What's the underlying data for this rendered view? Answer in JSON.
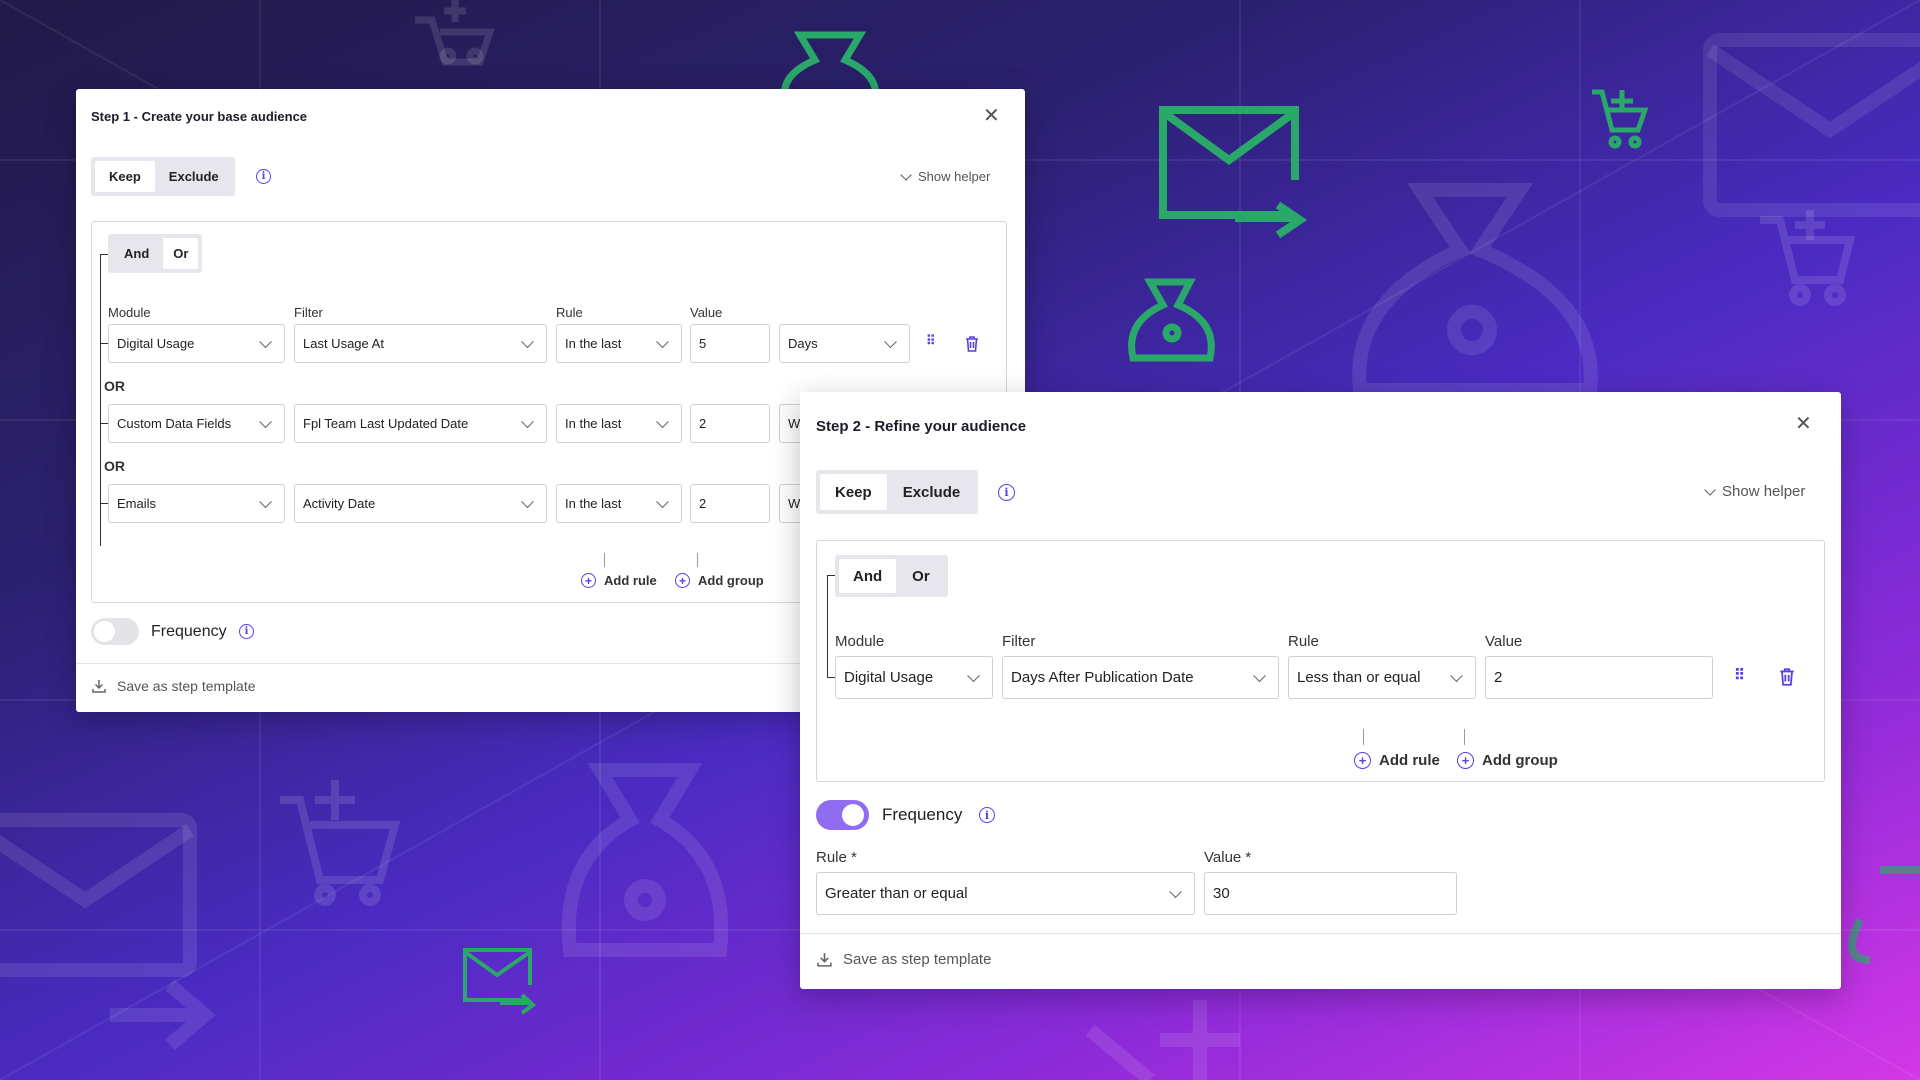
{
  "colors": {
    "accent": "#5b3fe0",
    "toggle_on": "#8f6cf0",
    "toggle_off": "#e3e3e8",
    "decor_green": "#2aa86a"
  },
  "step1": {
    "title": "Step 1 - Create your base audience",
    "keep": "Keep",
    "exclude": "Exclude",
    "show_helper": "Show helper",
    "and": "And",
    "or": "Or",
    "col_module": "Module",
    "col_filter": "Filter",
    "col_rule": "Rule",
    "col_value": "Value",
    "connector": "OR",
    "rows": [
      {
        "module": "Digital Usage",
        "filter": "Last Usage At",
        "rule": "In the last",
        "value": "5",
        "unit": "Days"
      },
      {
        "module": "Custom Data Fields",
        "filter": "Fpl Team Last Updated Date",
        "rule": "In the last",
        "value": "2",
        "unit": "W"
      },
      {
        "module": "Emails",
        "filter": "Activity Date",
        "rule": "In the last",
        "value": "2",
        "unit": "W"
      }
    ],
    "add_rule": "Add rule",
    "add_group": "Add group",
    "frequency": "Frequency",
    "save_template": "Save as step template"
  },
  "step2": {
    "title": "Step 2 - Refine your audience",
    "keep": "Keep",
    "exclude": "Exclude",
    "show_helper": "Show helper",
    "and": "And",
    "or": "Or",
    "col_module": "Module",
    "col_filter": "Filter",
    "col_rule": "Rule",
    "col_value": "Value",
    "row": {
      "module": "Digital Usage",
      "filter": "Days After Publication Date",
      "rule": "Less than or equal",
      "value": "2"
    },
    "add_rule": "Add rule",
    "add_group": "Add group",
    "frequency": "Frequency",
    "freq_rule_label": "Rule *",
    "freq_value_label": "Value *",
    "freq_rule": "Greater than or equal",
    "freq_value": "30",
    "save_template": "Save as step template"
  },
  "icons": [
    "cart-icon",
    "email-forward-icon",
    "money-bag-icon",
    "close-icon",
    "info-icon",
    "drag-handle-icon",
    "trash-icon",
    "plus-circle-icon",
    "download-icon"
  ]
}
